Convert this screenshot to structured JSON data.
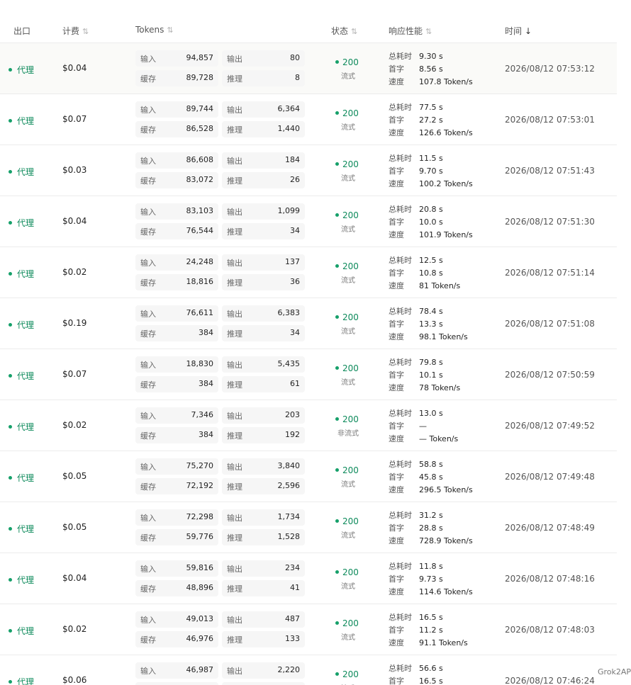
{
  "headers": {
    "outlet": "出口",
    "billing": "计费",
    "tokens": "Tokens",
    "status": "状态",
    "performance": "响应性能",
    "time": "时间",
    "sort_icon": "⇅",
    "sort_desc_icon": "↓"
  },
  "labels": {
    "input": "输入",
    "output": "输出",
    "cache": "缓存",
    "reasoning": "推理",
    "total": "总耗时",
    "first": "首字",
    "speed": "速度"
  },
  "colors": {
    "status_green": "#16a06a",
    "row_highlight": "#fafaf8"
  },
  "rows": [
    {
      "outlet": "代理",
      "cost": "$0.04",
      "input": "94,857",
      "output": "80",
      "cache": "89,728",
      "reasoning": "8",
      "status": "200",
      "mode": "流式",
      "total": "9.30 s",
      "first": "8.56 s",
      "speed": "107.8 Token/s",
      "time": "2026/08/12 07:53:12"
    },
    {
      "outlet": "代理",
      "cost": "$0.07",
      "input": "89,744",
      "output": "6,364",
      "cache": "86,528",
      "reasoning": "1,440",
      "status": "200",
      "mode": "流式",
      "total": "77.5 s",
      "first": "27.2 s",
      "speed": "126.6 Token/s",
      "time": "2026/08/12 07:53:01"
    },
    {
      "outlet": "代理",
      "cost": "$0.03",
      "input": "86,608",
      "output": "184",
      "cache": "83,072",
      "reasoning": "26",
      "status": "200",
      "mode": "流式",
      "total": "11.5 s",
      "first": "9.70 s",
      "speed": "100.2 Token/s",
      "time": "2026/08/12 07:51:43"
    },
    {
      "outlet": "代理",
      "cost": "$0.04",
      "input": "83,103",
      "output": "1,099",
      "cache": "76,544",
      "reasoning": "34",
      "status": "200",
      "mode": "流式",
      "total": "20.8 s",
      "first": "10.0 s",
      "speed": "101.9 Token/s",
      "time": "2026/08/12 07:51:30"
    },
    {
      "outlet": "代理",
      "cost": "$0.02",
      "input": "24,248",
      "output": "137",
      "cache": "18,816",
      "reasoning": "36",
      "status": "200",
      "mode": "流式",
      "total": "12.5 s",
      "first": "10.8 s",
      "speed": "81 Token/s",
      "time": "2026/08/12 07:51:14"
    },
    {
      "outlet": "代理",
      "cost": "$0.19",
      "input": "76,611",
      "output": "6,383",
      "cache": "384",
      "reasoning": "34",
      "status": "200",
      "mode": "流式",
      "total": "78.4 s",
      "first": "13.3 s",
      "speed": "98.1 Token/s",
      "time": "2026/08/12 07:51:08"
    },
    {
      "outlet": "代理",
      "cost": "$0.07",
      "input": "18,830",
      "output": "5,435",
      "cache": "384",
      "reasoning": "61",
      "status": "200",
      "mode": "流式",
      "total": "79.8 s",
      "first": "10.1 s",
      "speed": "78 Token/s",
      "time": "2026/08/12 07:50:59"
    },
    {
      "outlet": "代理",
      "cost": "$0.02",
      "input": "7,346",
      "output": "203",
      "cache": "384",
      "reasoning": "192",
      "status": "200",
      "mode": "非流式",
      "total": "13.0 s",
      "first": "—",
      "speed": "— Token/s",
      "time": "2026/08/12 07:49:52"
    },
    {
      "outlet": "代理",
      "cost": "$0.05",
      "input": "75,270",
      "output": "3,840",
      "cache": "72,192",
      "reasoning": "2,596",
      "status": "200",
      "mode": "流式",
      "total": "58.8 s",
      "first": "45.8 s",
      "speed": "296.5 Token/s",
      "time": "2026/08/12 07:49:48"
    },
    {
      "outlet": "代理",
      "cost": "$0.05",
      "input": "72,298",
      "output": "1,734",
      "cache": "59,776",
      "reasoning": "1,528",
      "status": "200",
      "mode": "流式",
      "total": "31.2 s",
      "first": "28.8 s",
      "speed": "728.9 Token/s",
      "time": "2026/08/12 07:48:49"
    },
    {
      "outlet": "代理",
      "cost": "$0.04",
      "input": "59,816",
      "output": "234",
      "cache": "48,896",
      "reasoning": "41",
      "status": "200",
      "mode": "流式",
      "total": "11.8 s",
      "first": "9.73 s",
      "speed": "114.6 Token/s",
      "time": "2026/08/12 07:48:16"
    },
    {
      "outlet": "代理",
      "cost": "$0.02",
      "input": "49,013",
      "output": "487",
      "cache": "46,976",
      "reasoning": "133",
      "status": "200",
      "mode": "流式",
      "total": "16.5 s",
      "first": "11.2 s",
      "speed": "91.1 Token/s",
      "time": "2026/08/12 07:48:03"
    },
    {
      "outlet": "代理",
      "cost": "$0.06",
      "input": "46,987",
      "output": "2,220",
      "cache": "",
      "reasoning": "",
      "status": "200",
      "mode": "流式",
      "total": "56.6 s",
      "first": "16.5 s",
      "speed": "",
      "time": "2026/08/12 07:46:24"
    }
  ],
  "watermark": "Grok2AP"
}
